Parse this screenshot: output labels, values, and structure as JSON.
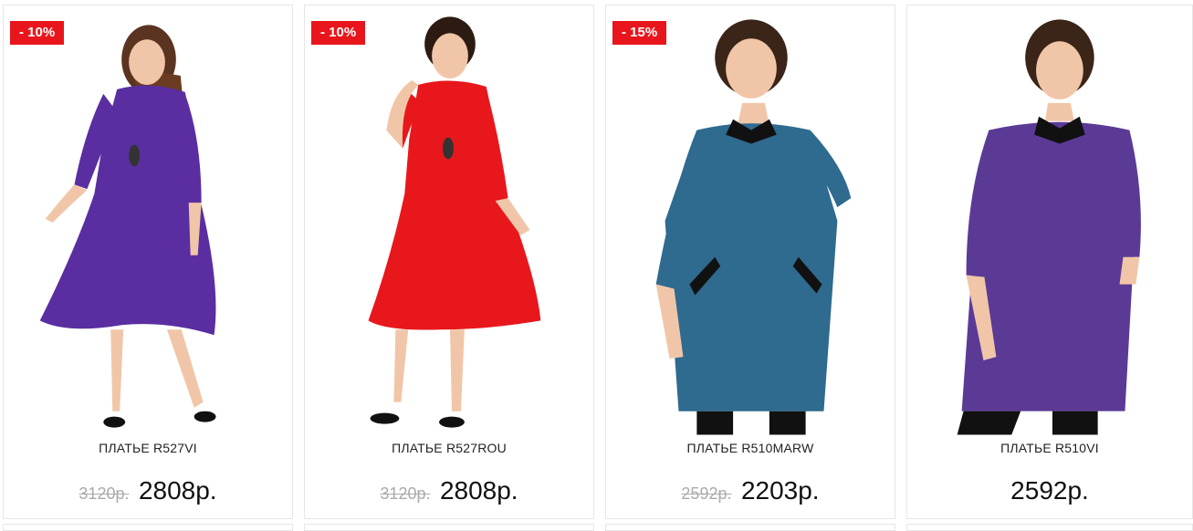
{
  "currency_suffix": "р.",
  "products": [
    {
      "discount_badge": "- 10%",
      "name": "ПЛАТЬЕ R527VI",
      "old_price": "3120р.",
      "price": "2808р.",
      "dress_color": "#5a2ea0"
    },
    {
      "discount_badge": "- 10%",
      "name": "ПЛАТЬЕ R527ROU",
      "old_price": "3120р.",
      "price": "2808р.",
      "dress_color": "#e8171c"
    },
    {
      "discount_badge": "- 15%",
      "name": "ПЛАТЬЕ R510MARW",
      "old_price": "2592р.",
      "price": "2203р.",
      "dress_color": "#2f6a8f"
    },
    {
      "discount_badge": "",
      "name": "ПЛАТЬЕ R510VI",
      "old_price": "",
      "price": "2592р.",
      "dress_color": "#5b3a96"
    }
  ],
  "colors": {
    "badge_bg": "#e8161c",
    "old_price": "#aaaaaa",
    "card_border": "#e6e6e6"
  }
}
